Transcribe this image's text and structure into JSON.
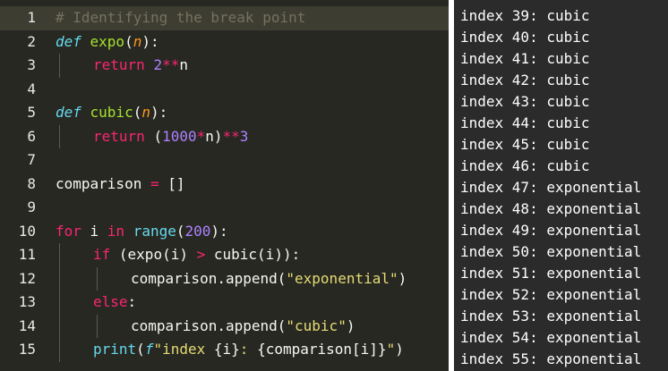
{
  "editor": {
    "line_numbers": [
      "1",
      "2",
      "3",
      "4",
      "5",
      "6",
      "7",
      "8",
      "9",
      "10",
      "11",
      "12",
      "13",
      "14",
      "15"
    ],
    "lines": [
      [
        {
          "c": "comment",
          "t": "# Identifying the break point"
        }
      ],
      [
        {
          "c": "def",
          "t": "def "
        },
        {
          "c": "fn",
          "t": "expo"
        },
        {
          "c": "plain",
          "t": "("
        },
        {
          "c": "param",
          "t": "n"
        },
        {
          "c": "plain",
          "t": "):"
        }
      ],
      [
        {
          "c": "kw",
          "t": "return "
        },
        {
          "c": "num",
          "t": "2"
        },
        {
          "c": "op",
          "t": "**"
        },
        {
          "c": "plain",
          "t": "n"
        }
      ],
      [],
      [
        {
          "c": "def",
          "t": "def "
        },
        {
          "c": "fn",
          "t": "cubic"
        },
        {
          "c": "plain",
          "t": "("
        },
        {
          "c": "param",
          "t": "n"
        },
        {
          "c": "plain",
          "t": "):"
        }
      ],
      [
        {
          "c": "kw",
          "t": "return "
        },
        {
          "c": "plain",
          "t": "("
        },
        {
          "c": "num",
          "t": "1000"
        },
        {
          "c": "op",
          "t": "*"
        },
        {
          "c": "plain",
          "t": "n)"
        },
        {
          "c": "op",
          "t": "**"
        },
        {
          "c": "num",
          "t": "3"
        }
      ],
      [],
      [
        {
          "c": "plain",
          "t": "comparison "
        },
        {
          "c": "op",
          "t": "="
        },
        {
          "c": "plain",
          "t": " []"
        }
      ],
      [],
      [
        {
          "c": "kw",
          "t": "for "
        },
        {
          "c": "plain",
          "t": "i "
        },
        {
          "c": "kw",
          "t": "in "
        },
        {
          "c": "builtin",
          "t": "range"
        },
        {
          "c": "plain",
          "t": "("
        },
        {
          "c": "num",
          "t": "200"
        },
        {
          "c": "plain",
          "t": "):"
        }
      ],
      [
        {
          "c": "kw",
          "t": "if "
        },
        {
          "c": "plain",
          "t": "(expo(i) "
        },
        {
          "c": "op",
          "t": ">"
        },
        {
          "c": "plain",
          "t": " cubic(i)):"
        }
      ],
      [
        {
          "c": "plain",
          "t": "comparison.append("
        },
        {
          "c": "str",
          "t": "\"exponential\""
        },
        {
          "c": "plain",
          "t": ")"
        }
      ],
      [
        {
          "c": "kw",
          "t": "else"
        },
        {
          "c": "plain",
          "t": ":"
        }
      ],
      [
        {
          "c": "plain",
          "t": "comparison.append("
        },
        {
          "c": "str",
          "t": "\"cubic\""
        },
        {
          "c": "plain",
          "t": ")"
        }
      ],
      [
        {
          "c": "builtin",
          "t": "print"
        },
        {
          "c": "plain",
          "t": "("
        },
        {
          "c": "fstr",
          "t": "f"
        },
        {
          "c": "str",
          "t": "\"index "
        },
        {
          "c": "plain",
          "t": "{i}"
        },
        {
          "c": "str",
          "t": ": "
        },
        {
          "c": "plain",
          "t": "{comparison[i]}"
        },
        {
          "c": "str",
          "t": "\""
        },
        {
          "c": "plain",
          "t": ")"
        }
      ]
    ]
  },
  "output": {
    "lines": [
      "index 39: cubic",
      "index 40: cubic",
      "index 41: cubic",
      "index 42: cubic",
      "index 43: cubic",
      "index 44: cubic",
      "index 45: cubic",
      "index 46: cubic",
      "index 47: exponential",
      "index 48: exponential",
      "index 49: exponential",
      "index 50: exponential",
      "index 51: exponential",
      "index 52: exponential",
      "index 53: exponential",
      "index 54: exponential",
      "index 55: exponential"
    ]
  },
  "colors": {
    "editor_bg": "#272822",
    "output_bg": "#2b2b2b",
    "keyword": "#f92672",
    "function": "#a6e22e",
    "string": "#e6db74",
    "number": "#ae81ff",
    "comment": "#75715e"
  }
}
